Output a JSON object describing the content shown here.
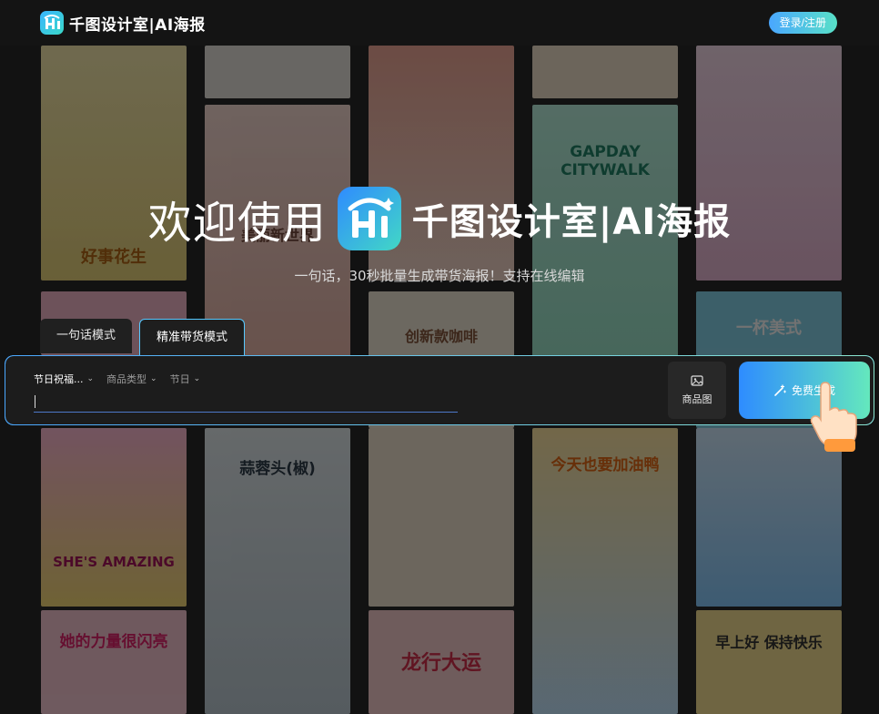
{
  "header": {
    "logo_text": "千图设计室|AI海报",
    "login_label": "登录/注册"
  },
  "hero": {
    "welcome": "欢迎使用",
    "brand": "千图设计室|AI海报",
    "subtitle": "一句话，30秒批量生成带货海报！支持在线编辑"
  },
  "tabs": [
    {
      "label": "一句话模式",
      "active": false
    },
    {
      "label": "精准带货模式",
      "active": true
    }
  ],
  "panel": {
    "selects": [
      {
        "label": "节日祝福...",
        "chevron": "chevron-down-icon"
      },
      {
        "label": "商品类型",
        "chevron": "chevron-down-icon"
      },
      {
        "label": "节日",
        "chevron": "chevron-down-icon"
      }
    ],
    "input_value": "",
    "product_image_label": "商品图",
    "generate_label": "免费生成"
  },
  "gallery": [
    {
      "text": "好事花生"
    },
    {
      "text": "美丽新世界"
    },
    {
      "text": "创新款咖啡"
    },
    {
      "text": "GAPDAY CITYWALK"
    },
    {
      "text": "一杯美式"
    },
    {
      "text": "SHE'S AMAZING"
    },
    {
      "text": "她的力量很闪亮"
    },
    {
      "text": "蒜蓉头(椒)"
    },
    {
      "text": "龙行大运"
    },
    {
      "text": "今天也要加油鸭"
    },
    {
      "text": "早上好 保持快乐"
    }
  ],
  "colors": {
    "background": "#141414",
    "accent_blue": "#2e8cff",
    "accent_teal": "#64e8bd"
  }
}
